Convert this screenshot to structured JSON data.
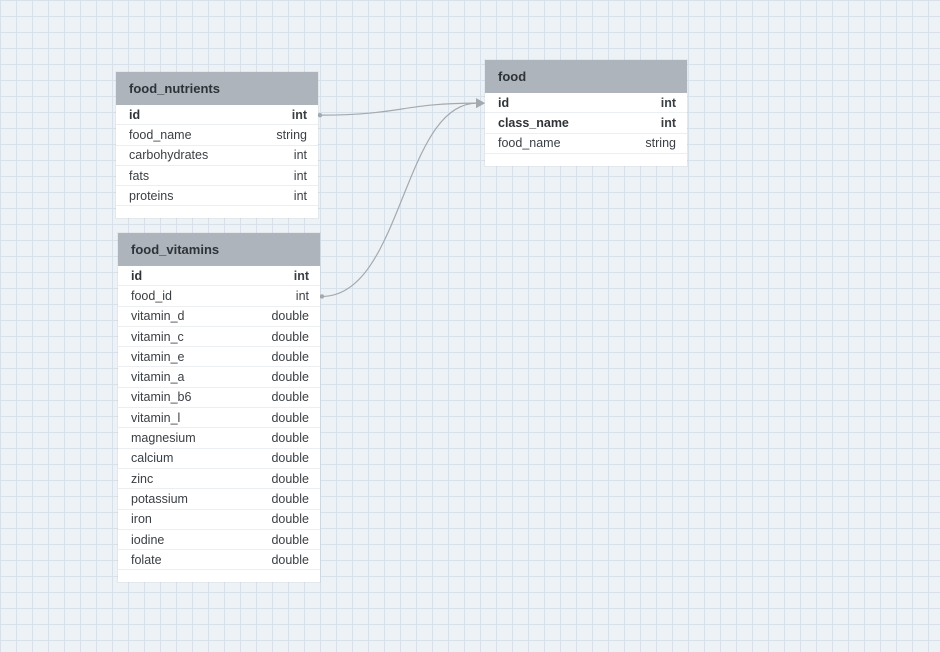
{
  "tables": {
    "food_nutrients": {
      "name": "food_nutrients",
      "columns": [
        {
          "name": "id",
          "type": "int",
          "pk": true
        },
        {
          "name": "food_name",
          "type": "string"
        },
        {
          "name": "carbohydrates",
          "type": "int"
        },
        {
          "name": "fats",
          "type": "int"
        },
        {
          "name": "proteins",
          "type": "int"
        }
      ]
    },
    "food": {
      "name": "food",
      "columns": [
        {
          "name": "id",
          "type": "int",
          "pk": true
        },
        {
          "name": "class_name",
          "type": "int",
          "pk": true
        },
        {
          "name": "food_name",
          "type": "string"
        }
      ]
    },
    "food_vitamins": {
      "name": "food_vitamins",
      "columns": [
        {
          "name": "id",
          "type": "int",
          "pk": true
        },
        {
          "name": "food_id",
          "type": "int"
        },
        {
          "name": "vitamin_d",
          "type": "double"
        },
        {
          "name": "vitamin_c",
          "type": "double"
        },
        {
          "name": "vitamin_e",
          "type": "double"
        },
        {
          "name": "vitamin_a",
          "type": "double"
        },
        {
          "name": "vitamin_b6",
          "type": "double"
        },
        {
          "name": "vitamin_l",
          "type": "double"
        },
        {
          "name": "magnesium",
          "type": "double"
        },
        {
          "name": "calcium",
          "type": "double"
        },
        {
          "name": "zinc",
          "type": "double"
        },
        {
          "name": "potassium",
          "type": "double"
        },
        {
          "name": "iron",
          "type": "double"
        },
        {
          "name": "iodine",
          "type": "double"
        },
        {
          "name": "folate",
          "type": "double"
        }
      ]
    }
  },
  "relations": [
    {
      "from_table": "food_nutrients",
      "from_column": "id",
      "to_table": "food",
      "to_column": "id"
    },
    {
      "from_table": "food_vitamins",
      "from_column": "food_id",
      "to_table": "food",
      "to_column": "id"
    }
  ],
  "colors": {
    "canvas": "#edf2f6",
    "grid": "#d8e1ea",
    "header": "#adb4bb",
    "connector": "#a3a9ae"
  }
}
